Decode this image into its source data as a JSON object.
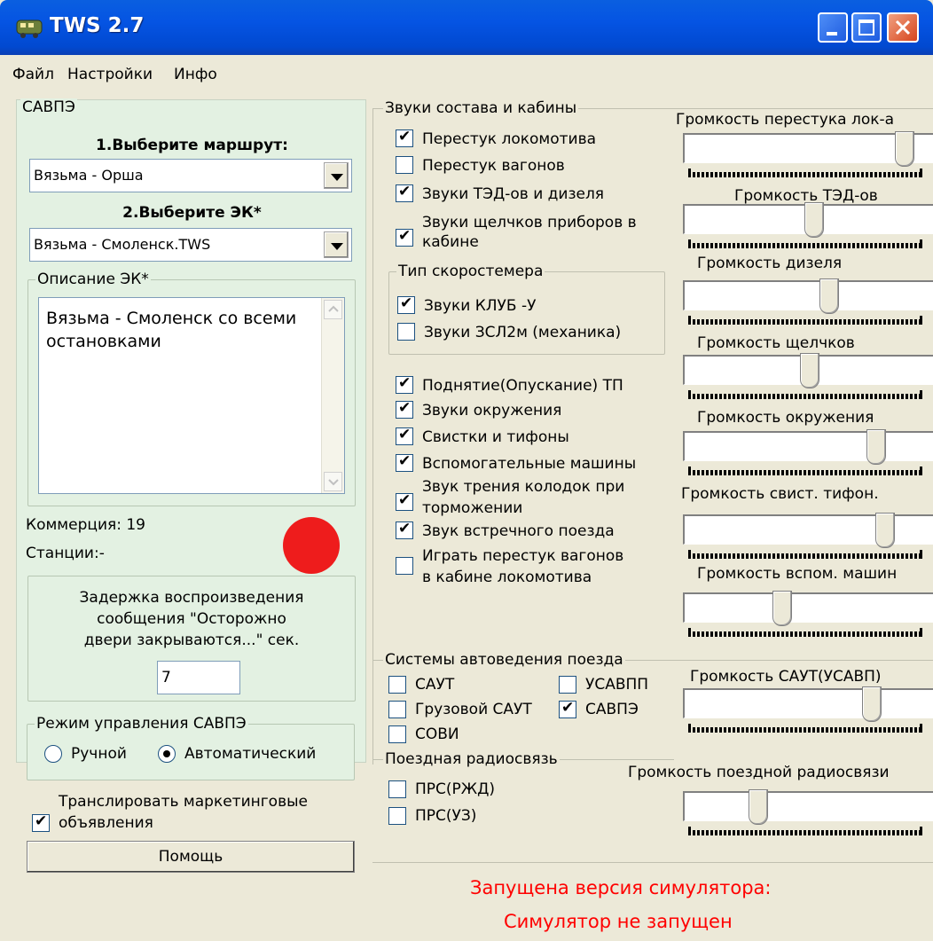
{
  "window": {
    "title": "TWS 2.7"
  },
  "menu": {
    "items": [
      "Файл",
      "Настройки",
      "Инфо"
    ]
  },
  "savpe": {
    "group_title": "САВПЭ",
    "route_header": "1.Выберите маршрут:",
    "route_value": "Вязьма - Орша",
    "ek_header": "2.Выберите ЭК*",
    "ek_value": "Вязьма - Смоленск.TWS",
    "desc_title": "Описание ЭК*",
    "desc_text": "Вязьма - Смоленск со всеми остановками",
    "commerce_label": "Коммерция: 19",
    "stations_label": "Станции:-",
    "status_color": "#ee1c1c",
    "delay_text_1": "Задержка  воспроизведения",
    "delay_text_2": "сообщения \"Осторожно",
    "delay_text_3": "двери закрываются...\" сек.",
    "delay_value": "7",
    "mode_title": "Режим управления САВПЭ",
    "mode_manual": "Ручной",
    "mode_auto": "Автоматический",
    "mode_selected": "auto",
    "marketing_1": "Транслировать маркетинговые",
    "marketing_2": "объявления",
    "marketing_checked": true,
    "help_button": "Помощь"
  },
  "sounds": {
    "group_title": "Звуки состава и кабины",
    "items": [
      {
        "label": "Перестук локомотива",
        "checked": true
      },
      {
        "label": "Перестук вагонов",
        "checked": false
      },
      {
        "label": "Звуки ТЭД-ов и дизеля",
        "checked": true
      },
      {
        "label": "Звуки щелчков приборов в",
        "label2": "кабине",
        "checked": true
      }
    ],
    "speedometer_title": "Тип скоростемера",
    "speedometer": [
      {
        "label": "Звуки КЛУБ -У",
        "checked": true
      },
      {
        "label": "Звуки ЗСЛ2м (механика)",
        "checked": false
      }
    ],
    "items2": [
      {
        "label": "Поднятие(Опускание) ТП",
        "checked": true
      },
      {
        "label": "Звуки окружения",
        "checked": true
      },
      {
        "label": "Свистки и тифоны",
        "checked": true
      },
      {
        "label": "Вспомогательные машины",
        "checked": true
      },
      {
        "label": "Звук трения колодок при",
        "label2": "торможении",
        "checked": true
      },
      {
        "label": "Звук встречного поезда",
        "checked": true
      },
      {
        "label": "Играть перестук вагонов",
        "label2": "в кабине локомотива",
        "checked": false
      }
    ]
  },
  "volumes": [
    {
      "label": "Громкость перестука лок-а",
      "value": 0.97
    },
    {
      "label": "Громкость ТЭД-ов",
      "value": 0.55
    },
    {
      "label": "Громкость дизеля",
      "value": 0.62
    },
    {
      "label": "Громкость щелчков",
      "value": 0.53
    },
    {
      "label": "Громкость окружения",
      "value": 0.84
    },
    {
      "label": "Громкость свист. тифон.",
      "value": 0.88
    },
    {
      "label": "Громкость вспом. машин",
      "value": 0.4
    },
    {
      "label": "Громкость САУТ(УСАВП)",
      "value": 0.82
    },
    {
      "label": "Громкость поездной радиосвязи",
      "value": 0.29
    }
  ],
  "auto": {
    "group_title": "Системы автоведения поезда",
    "items": [
      {
        "label": "САУТ",
        "checked": false
      },
      {
        "label": "УСАВПП",
        "checked": false
      },
      {
        "label": "Грузовой САУТ",
        "checked": false
      },
      {
        "label": "САВПЭ",
        "checked": true
      },
      {
        "label": "СОВИ",
        "checked": false
      }
    ]
  },
  "radio": {
    "group_title": "Поездная радиосвязь",
    "items": [
      {
        "label": "ПРС(РЖД)",
        "checked": false
      },
      {
        "label": "ПРС(УЗ)",
        "checked": false
      }
    ]
  },
  "status": {
    "line1": "Запущена версия симулятора:",
    "line2": "Симулятор не запущен",
    "color": "#ff0000"
  }
}
